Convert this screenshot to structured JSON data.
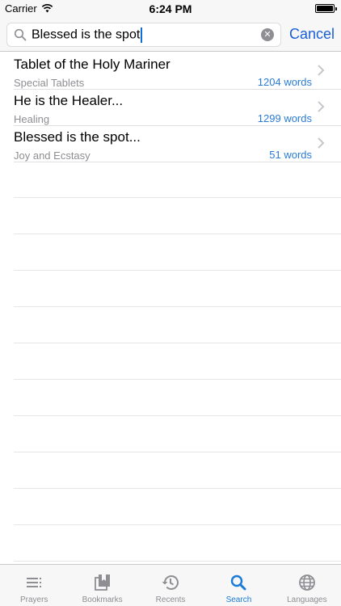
{
  "status_bar": {
    "carrier": "Carrier",
    "time": "6:24 PM"
  },
  "search": {
    "query": "Blessed is the spot",
    "cancel_label": "Cancel"
  },
  "results": [
    {
      "title": "Tablet of the Holy Mariner",
      "category": "Special Tablets",
      "words": "1204 words"
    },
    {
      "title": "He is the Healer...",
      "category": "Healing",
      "words": "1299 words"
    },
    {
      "title": "Blessed is the spot...",
      "category": "Joy and Ecstasy",
      "words": "51 words"
    }
  ],
  "tab_bar": {
    "tabs": [
      {
        "label": "Prayers",
        "icon": "list-icon"
      },
      {
        "label": "Bookmarks",
        "icon": "bookmarks-icon"
      },
      {
        "label": "Recents",
        "icon": "history-icon"
      },
      {
        "label": "Search",
        "icon": "search-icon",
        "active": true
      },
      {
        "label": "Languages",
        "icon": "globe-icon"
      }
    ]
  },
  "colors": {
    "accent": "#1a7bd6",
    "word_count": "#2a7bd6",
    "secondary_text": "#8e8e93"
  }
}
